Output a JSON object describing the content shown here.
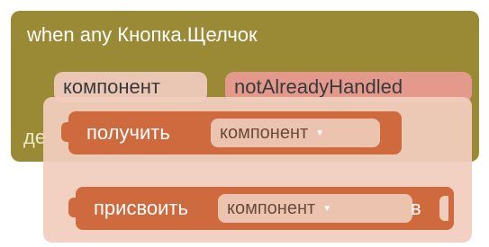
{
  "event_block": {
    "title": "when any Кнопка.Щелчок",
    "params": {
      "component": "компонент",
      "not_already_handled": "notAlreadyHandled"
    },
    "do_label": "де"
  },
  "get_block": {
    "label": "получить",
    "dropdown_value": "компонент",
    "arrow": "▼"
  },
  "set_block": {
    "label": "присвоить",
    "dropdown_value": "компонент",
    "arrow": "▼",
    "to_label": "в"
  },
  "colors": {
    "event": "#9b8a35",
    "value_block": "#cf6a3e",
    "overlay": "#f1cdbe",
    "param_handled": "#e39a8d"
  }
}
